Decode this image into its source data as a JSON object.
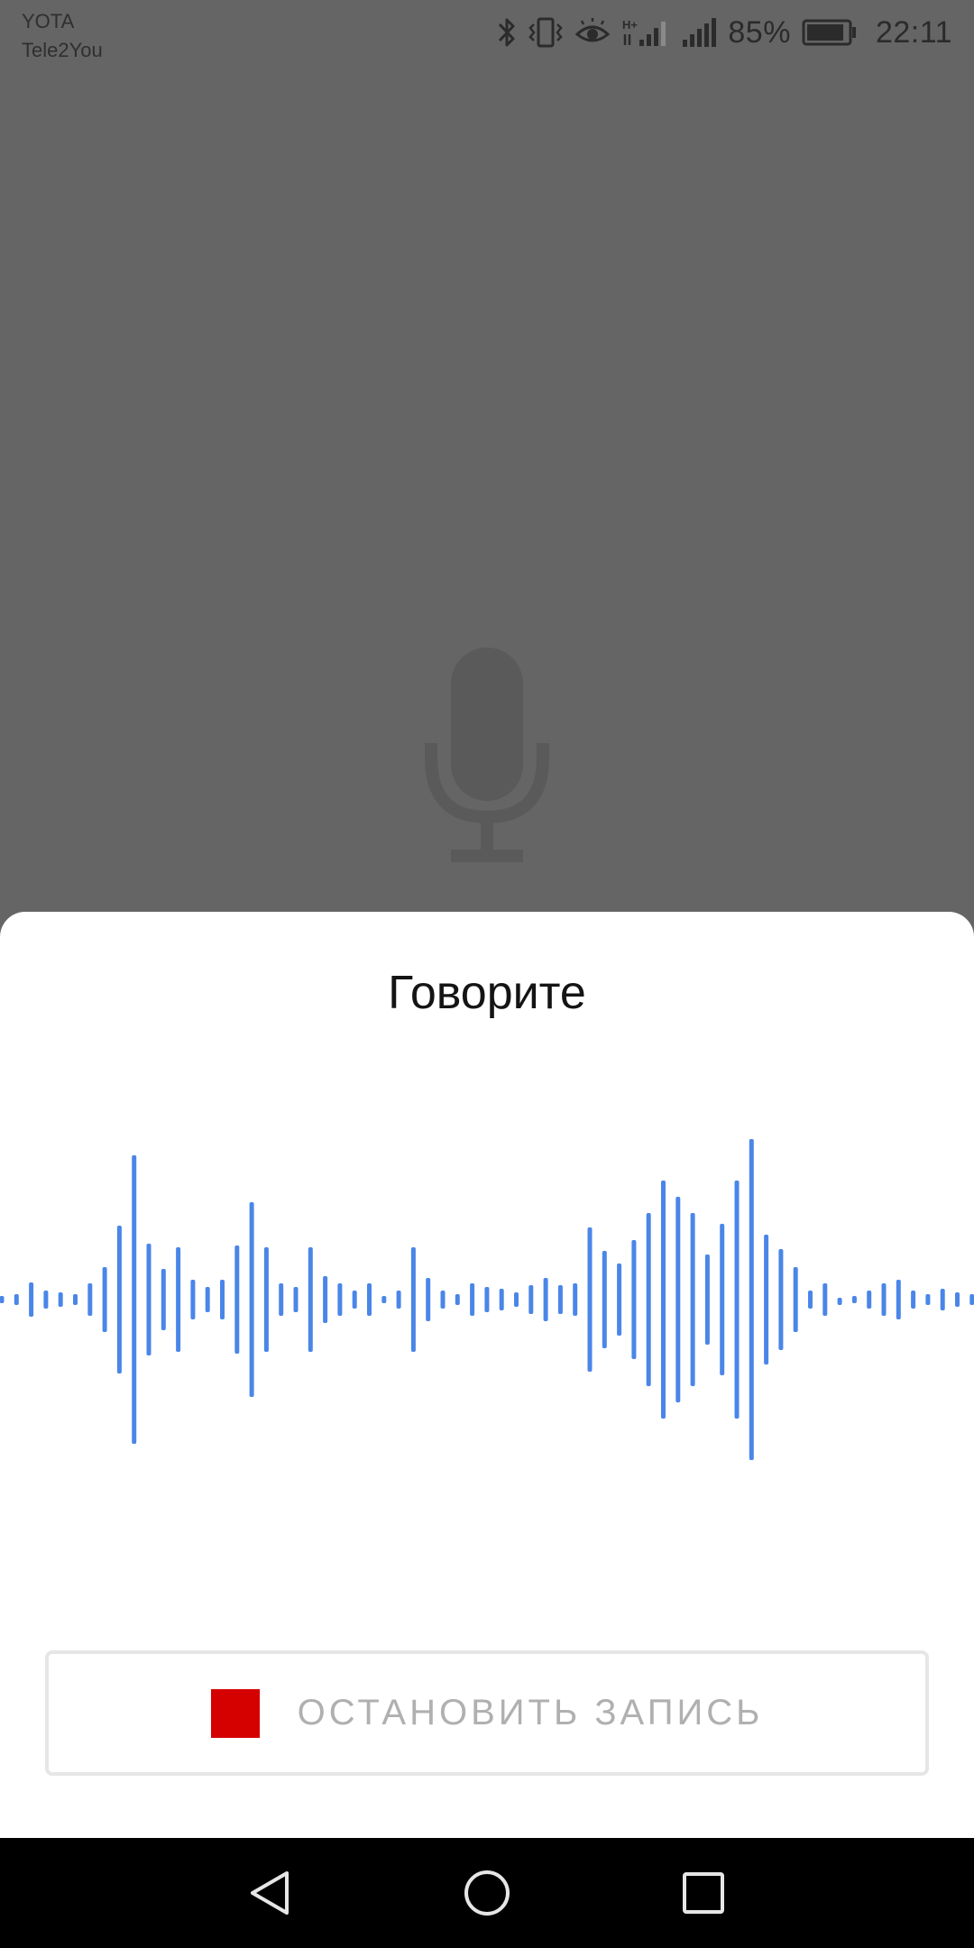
{
  "status_bar": {
    "carrier_1": "YOTA",
    "carrier_2": "Tele2You",
    "battery_percent": "85%",
    "time": "22:11",
    "icons": [
      "bluetooth-icon",
      "vibrate-icon",
      "eye-comfort-icon",
      "mobile-data-hplus-signal-icon",
      "cellular-signal-icon",
      "battery-icon"
    ]
  },
  "background": {
    "icon": "microphone-icon"
  },
  "voice_sheet": {
    "title": "Говорите",
    "stop_button_label": "ОСТАНОВИТЬ ЗАПИСЬ",
    "stop_icon": "stop-square-icon",
    "colors": {
      "waveform": "#4a86e8",
      "stop": "#d50000"
    }
  },
  "nav_bar": {
    "buttons": [
      "back-triangle-icon",
      "home-circle-icon",
      "recents-square-icon"
    ]
  }
}
